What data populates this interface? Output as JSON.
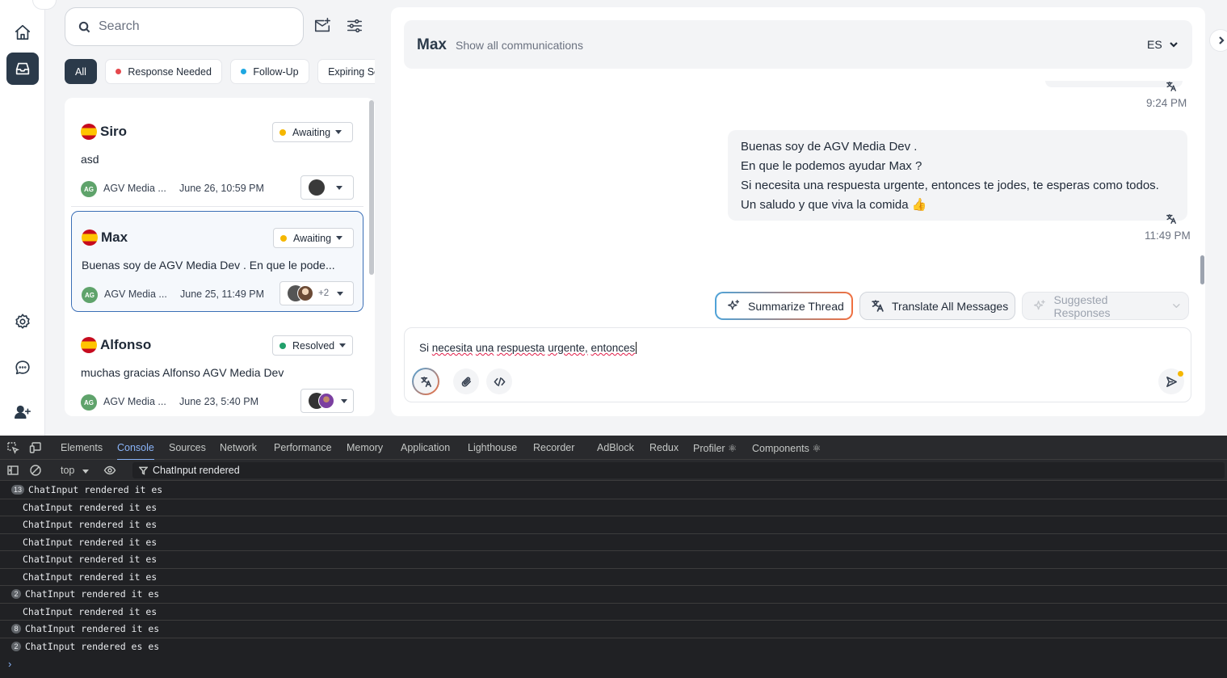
{
  "rail": {
    "items": [
      {
        "name": "home",
        "active": false
      },
      {
        "name": "inbox",
        "active": true
      },
      {
        "name": "settings",
        "active": false
      },
      {
        "name": "chat",
        "active": false
      },
      {
        "name": "add-user",
        "active": false
      }
    ]
  },
  "search": {
    "placeholder": "Search",
    "value": ""
  },
  "filters": {
    "chips": [
      {
        "label": "All",
        "active": true
      },
      {
        "label": "Response Needed",
        "dot": "#e5484d"
      },
      {
        "label": "Follow-Up",
        "dot": "#1ea7e1"
      },
      {
        "label": "Expiring Soon"
      }
    ]
  },
  "conversations": [
    {
      "name": "Siro",
      "status": "Awaiting",
      "status_color": "#f5b700",
      "preview": "asd",
      "org_initials": "AG",
      "org": "AGV Media ...",
      "date": "June 26, 10:59 PM",
      "assignees_extra": ""
    },
    {
      "name": "Max",
      "status": "Awaiting",
      "status_color": "#f5b700",
      "preview": "Buenas soy de AGV Media Dev . En que le pode...",
      "org_initials": "AG",
      "org": "AGV Media ...",
      "date": "June 25, 11:49 PM",
      "assignees_extra": "+2",
      "selected": true
    },
    {
      "name": "Alfonso",
      "status": "Resolved",
      "status_color": "#22a06b",
      "preview": "muchas gracias Alfonso AGV Media Dev",
      "org_initials": "AG",
      "org": "AGV Media ...",
      "date": "June 23, 5:40 PM",
      "assignees_extra": ""
    }
  ],
  "chat": {
    "contact_name": "Max",
    "show_all": "Show all communications",
    "language": "ES",
    "messages": [
      {
        "time": "9:24 PM"
      },
      {
        "lines": [
          "Buenas soy de AGV Media Dev .",
          "En que le podemos ayudar Max ?",
          "Si necesita una respuesta urgente, entonces te jodes, te esperas como todos.",
          "Un saludo y que viva la comida 👍"
        ],
        "time": "11:49 PM"
      }
    ],
    "actions": {
      "summarize": "Summarize Thread",
      "translate": "Translate All Messages",
      "suggested": "Suggested Responses"
    },
    "composer": {
      "text_parts": [
        "Si ",
        "necesita",
        " ",
        "una",
        " ",
        "respuesta",
        " ",
        "urgente,",
        " ",
        "entonces"
      ]
    }
  },
  "devtools": {
    "tabs": [
      "Elements",
      "Console",
      "Sources",
      "Network",
      "Performance",
      "Memory",
      "Application",
      "Lighthouse",
      "Recorder",
      "AdBlock",
      "Redux",
      "Profiler ⚛",
      "Components ⚛"
    ],
    "active_tab": "Console",
    "context": "top",
    "filter": "ChatInput rendered",
    "logs": [
      {
        "count": "13",
        "text": "ChatInput rendered it es"
      },
      {
        "count": "",
        "text": "ChatInput rendered it es"
      },
      {
        "count": "",
        "text": "ChatInput rendered it es"
      },
      {
        "count": "",
        "text": "ChatInput rendered it es"
      },
      {
        "count": "",
        "text": "ChatInput rendered it es"
      },
      {
        "count": "",
        "text": "ChatInput rendered it es"
      },
      {
        "count": "2",
        "text": "ChatInput rendered it es"
      },
      {
        "count": "",
        "text": "ChatInput rendered it es"
      },
      {
        "count": "8",
        "text": "ChatInput rendered it es"
      },
      {
        "count": "2",
        "text": "ChatInput rendered es es"
      }
    ]
  }
}
